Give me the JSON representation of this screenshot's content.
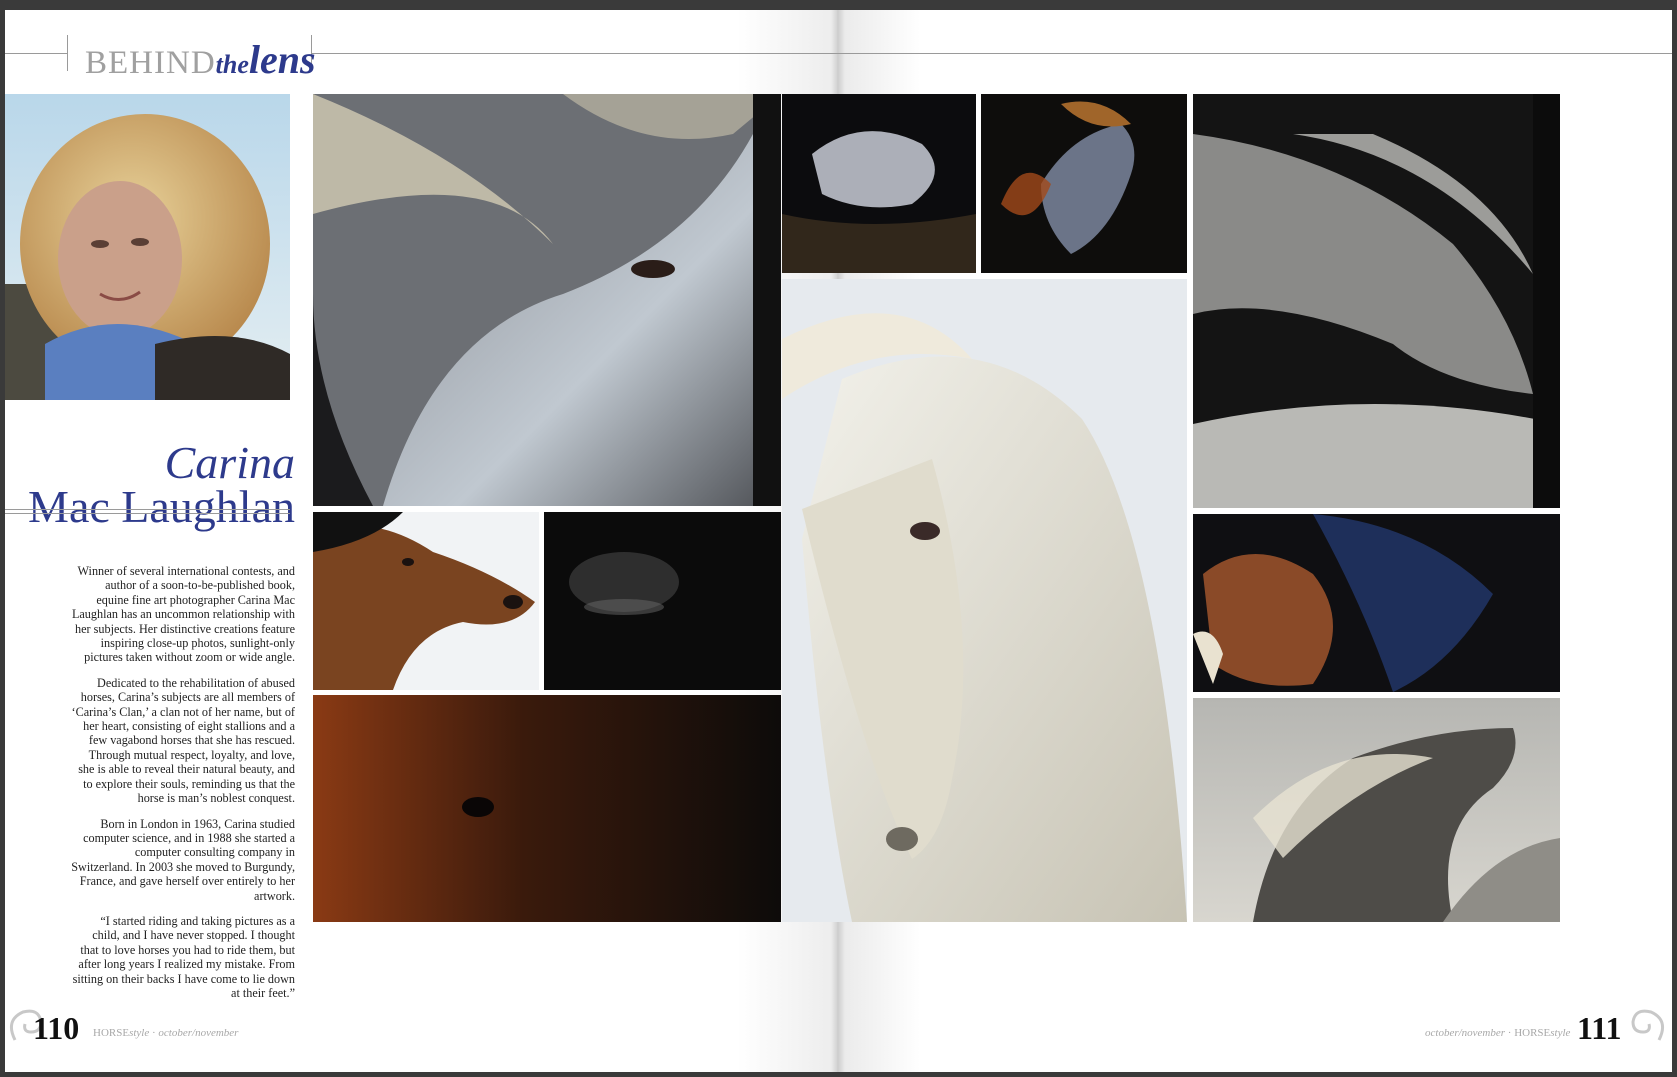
{
  "header": {
    "section_behind": "BEHIND",
    "section_the": "the",
    "section_lens": "lens"
  },
  "profile": {
    "first_name": "Carina",
    "last_name": "Mac Laughlan"
  },
  "article": {
    "paragraphs": [
      "Winner of several international contests, and author of a soon-to-be-published book, equine fine art photographer Carina Mac Laughlan has an uncommon relationship with her subjects. Her distinctive creations feature inspiring close-up photos, sunlight-only pictures taken without zoom or wide angle.",
      "Dedicated to the rehabilitation of abused horses, Carina’s subjects are all members of ‘Carina’s Clan,’ a clan not of her name, but of her heart, consisting of eight stallions and a few vagabond horses that she has rescued. Through mutual respect, loyalty, and love, she is able to reveal their natural beauty, and to explore their souls, reminding us that the horse is man’s noblest conquest.",
      "Born in London in 1963, Carina studied computer science, and in 1988 she started a computer consulting company in Switzerland. In 2003 she moved to Burgundy, France, and gave herself over entirely to her artwork.",
      "“I started riding and taking pictures as a child, and I have never stopped. I thought that to love horses you had to ride them, but after long years I realized my mistake. From sitting on their backs I have come to lie down at their feet.”"
    ]
  },
  "footer_left": {
    "page_number": "110",
    "magazine": "HORSE",
    "magazine_suffix": "style",
    "issue": "october/november"
  },
  "footer_right": {
    "page_number": "111",
    "magazine": "HORSE",
    "magazine_suffix": "style",
    "issue": "october/november"
  },
  "colors": {
    "accent_blue": "#2d3a8c",
    "rule_gray": "#9a9a9a"
  }
}
